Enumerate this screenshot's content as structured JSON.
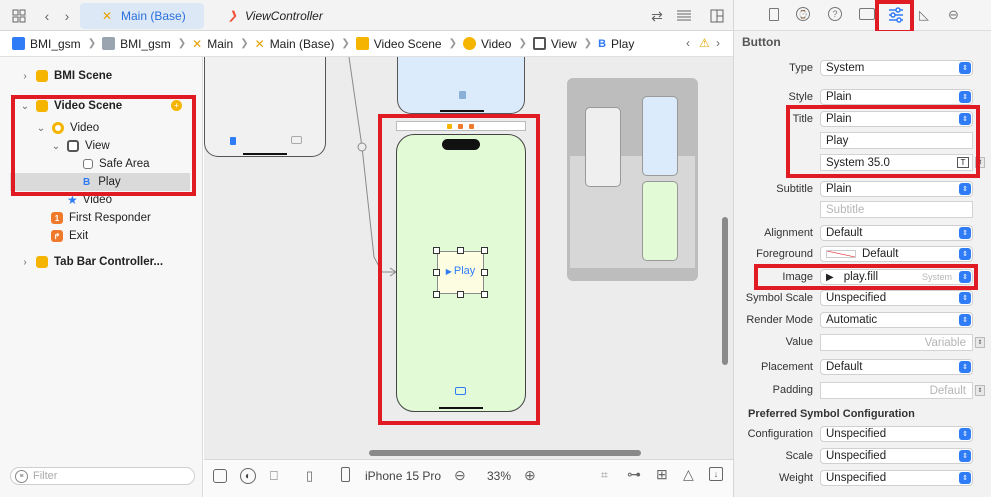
{
  "tabs": [
    {
      "label": "Main (Base)",
      "active": true
    },
    {
      "label": "ViewController",
      "active": false
    }
  ],
  "jumpbar": {
    "items": [
      "BMI_gsm",
      "BMI_gsm",
      "Main",
      "Main (Base)",
      "Video Scene",
      "Video",
      "View",
      "Play"
    ]
  },
  "navigator": {
    "rows": [
      {
        "label": "BMI Scene",
        "bold": true
      },
      {
        "label": "Video Scene",
        "bold": true
      },
      {
        "label": "Video"
      },
      {
        "label": "View"
      },
      {
        "label": "Safe Area"
      },
      {
        "label": "Play"
      },
      {
        "label": "Video"
      },
      {
        "label": "First Responder"
      },
      {
        "label": "Exit"
      },
      {
        "label": "Tab Bar Controller...",
        "bold": true
      }
    ],
    "filter_placeholder": "Filter"
  },
  "canvas": {
    "button_title": "Play",
    "play_glyph": "▶"
  },
  "bottombar": {
    "device": "iPhone 15 Pro",
    "zoom": "33%"
  },
  "inspector": {
    "section_title": "Button",
    "type": {
      "label": "Type",
      "value": "System"
    },
    "style": {
      "label": "Style",
      "value": "Plain"
    },
    "title": {
      "label": "Title",
      "value": "Plain",
      "text": "Play",
      "font": "System 35.0"
    },
    "subtitle": {
      "label": "Subtitle",
      "value": "Plain",
      "placeholder": "Subtitle"
    },
    "alignment": {
      "label": "Alignment",
      "value": "Default"
    },
    "foreground": {
      "label": "Foreground",
      "value": "Default"
    },
    "image": {
      "label": "Image",
      "value": "play.fill",
      "hint": "System"
    },
    "symbol_scale": {
      "label": "Symbol Scale",
      "value": "Unspecified"
    },
    "render_mode": {
      "label": "Render Mode",
      "value": "Automatic"
    },
    "value": {
      "label": "Value",
      "placeholder": "Variable"
    },
    "placement": {
      "label": "Placement",
      "value": "Default"
    },
    "padding": {
      "label": "Padding",
      "placeholder": "Default"
    },
    "psc_title": "Preferred Symbol Configuration",
    "configuration": {
      "label": "Configuration",
      "value": "Unspecified"
    },
    "scale": {
      "label": "Scale",
      "value": "Unspecified"
    },
    "weight": {
      "label": "Weight",
      "value": "Unspecified"
    }
  },
  "colors": {
    "accent": "#2f7cf6",
    "highlight": "#e01b24",
    "scene_green": "#e3fad6",
    "scene_blue": "#dcebfb",
    "scene_icon_yellow": "#f5b400"
  }
}
